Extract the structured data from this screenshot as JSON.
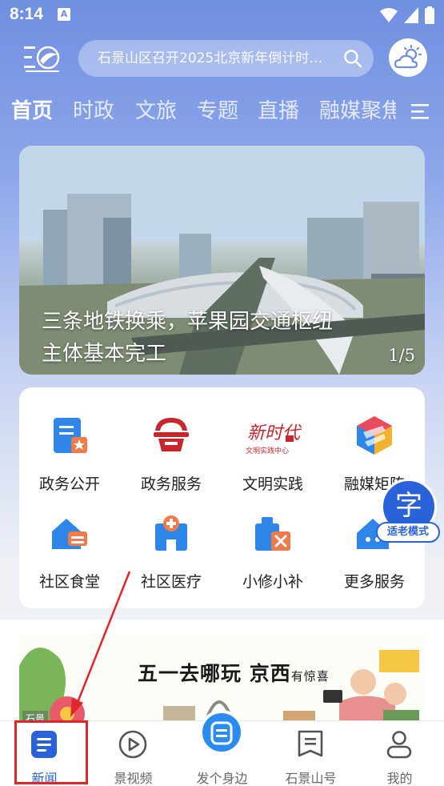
{
  "status_bar": {
    "time": "8:14",
    "notification_letter": "A"
  },
  "header": {
    "search_placeholder": "石景山区召开2025北京新年倒计时…"
  },
  "tabs": [
    {
      "label": "首页",
      "active": true
    },
    {
      "label": "时政",
      "active": false
    },
    {
      "label": "文旅",
      "active": false
    },
    {
      "label": "专题",
      "active": false
    },
    {
      "label": "直播",
      "active": false
    },
    {
      "label": "融媒聚焦",
      "active": false
    }
  ],
  "banner": {
    "caption_line1": "三条地铁换乘，苹果园交通枢纽",
    "caption_line2": "主体基本完工",
    "counter": "1/5"
  },
  "services": [
    {
      "label": "政务公开",
      "icon": "gov-open-icon"
    },
    {
      "label": "政务服务",
      "icon": "gov-service-icon"
    },
    {
      "label": "文明实践",
      "icon": "civilization-icon"
    },
    {
      "label": "融媒矩阵",
      "icon": "media-matrix-icon"
    },
    {
      "label": "社区食堂",
      "icon": "canteen-icon"
    },
    {
      "label": "社区医疗",
      "icon": "clinic-icon"
    },
    {
      "label": "小修小补",
      "icon": "repair-icon"
    },
    {
      "label": "更多服务",
      "icon": "more-services-icon"
    }
  ],
  "civilization_logo_text": {
    "art": "新时代",
    "sub": "文明实践中心"
  },
  "elder_mode": {
    "glyph": "字",
    "label": "适老模式"
  },
  "promo": {
    "slogan_main": "五一去哪玩 京西",
    "slogan_small": "有惊喜",
    "corner_tag": "石景"
  },
  "bottom_nav": [
    {
      "label": "新闻",
      "active": true
    },
    {
      "label": "景视频",
      "active": false
    },
    {
      "label": "发个身边",
      "active": false
    },
    {
      "label": "石景山号",
      "active": false
    },
    {
      "label": "我的",
      "active": false
    }
  ],
  "colors": {
    "accent": "#2a63d9",
    "highlight": "#e0262a",
    "header_bg": "#6f8fe0"
  }
}
